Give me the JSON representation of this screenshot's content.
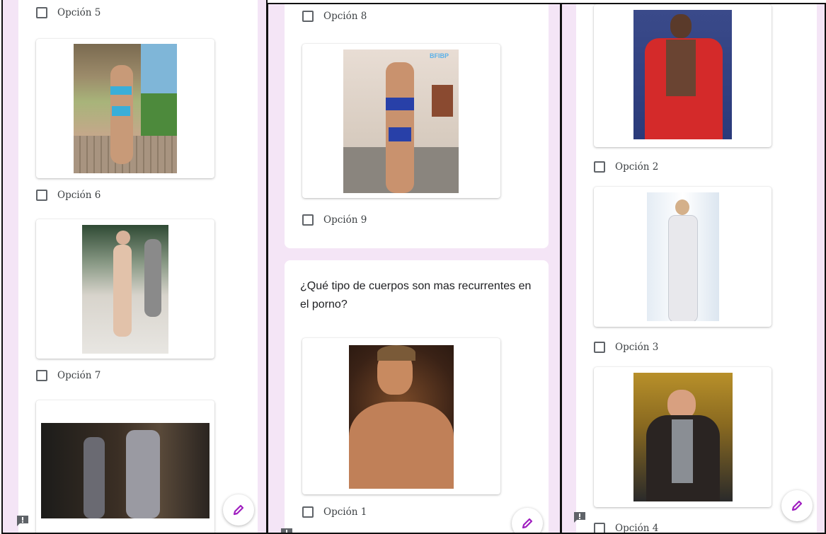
{
  "panel_left": {
    "options": [
      "Opción 5",
      "Opción 6",
      "Opción 7"
    ],
    "images": [
      "beach-house-swimsuit-photo",
      "runway-model-photo",
      "two-women-sequined-outfits-photo"
    ]
  },
  "panel_middle": {
    "options": [
      "Opción 8",
      "Opción 9",
      "Opción 1"
    ],
    "question": "¿Qué tipo de cuerpos son mas recurrentes en el porno?",
    "images": [
      "fitness-bikini-photo",
      "shirtless-man-portrait-photo"
    ],
    "watermark": "BFIBP"
  },
  "panel_right": {
    "options": [
      "Opción 2",
      "Opción 3",
      "Opción 4"
    ],
    "images": [
      "red-suit-man-photo",
      "white-outfit-model-photo",
      "dark-blazer-man-photo"
    ]
  },
  "icons": {
    "edit": "pencil-icon",
    "feedback": "feedback-icon"
  },
  "colors": {
    "background": "#f4e5f6",
    "accent": "#a020c0"
  }
}
